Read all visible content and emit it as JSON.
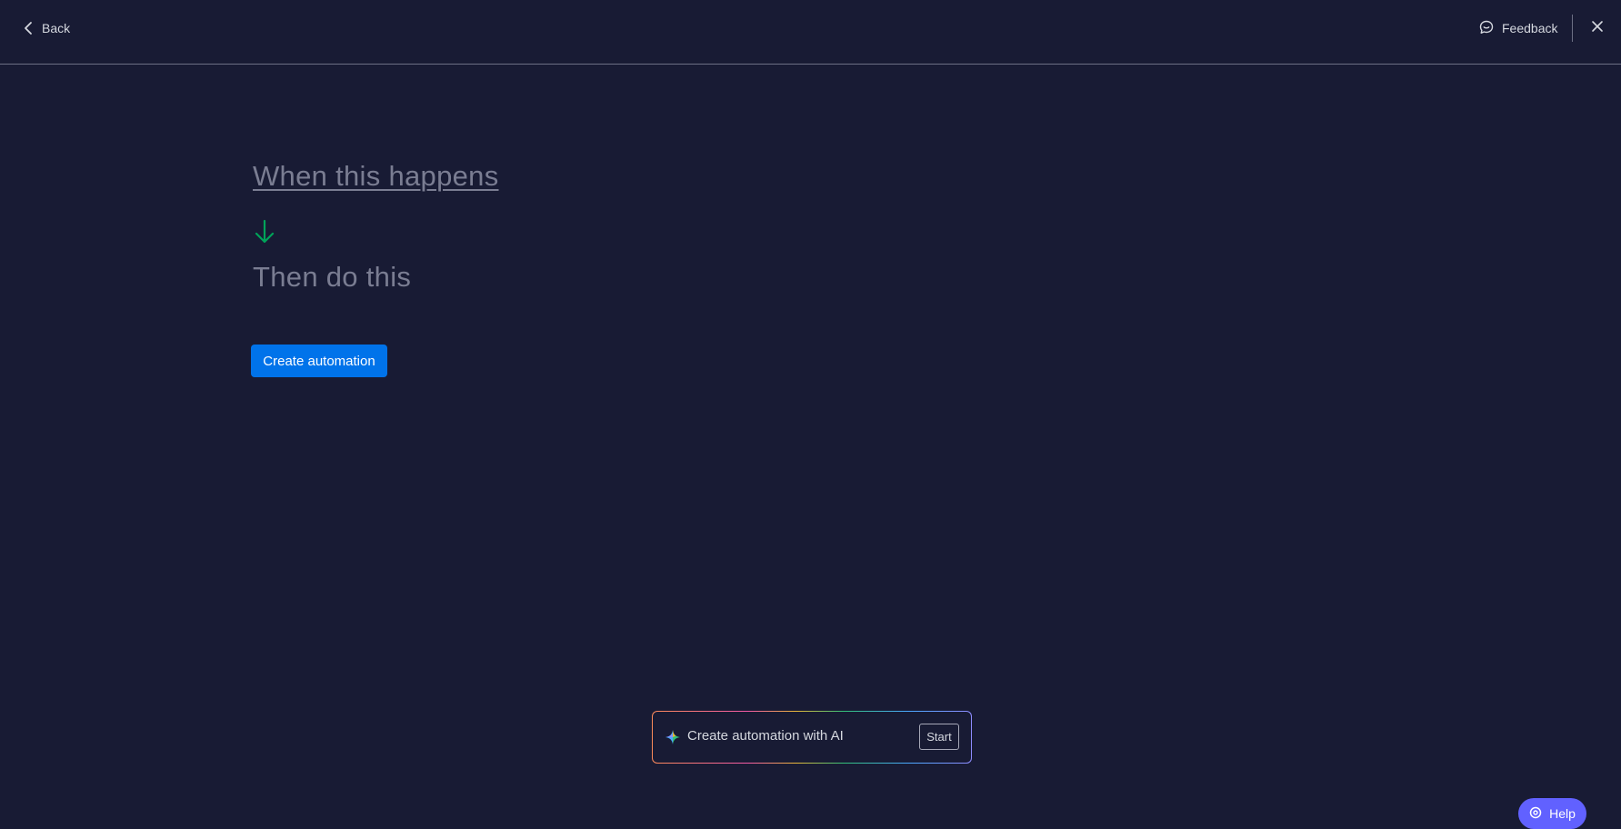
{
  "header": {
    "back_label": "Back",
    "feedback_label": "Feedback"
  },
  "builder": {
    "trigger_placeholder": "When this happens",
    "action_placeholder": "Then do this",
    "create_button_label": "Create automation"
  },
  "ai_prompt": {
    "label": "Create automation with AI",
    "start_label": "Start"
  },
  "help": {
    "label": "Help"
  },
  "colors": {
    "background": "#181b34",
    "primary_button": "#0073ea",
    "arrow": "#00a359",
    "help_button": "#6161ff"
  },
  "icons": {
    "back": "chevron-left-icon",
    "feedback": "chat-bubble-icon",
    "close": "close-icon",
    "arrow": "arrow-down-icon",
    "ai": "sparkle-icon",
    "help": "help-icon"
  }
}
